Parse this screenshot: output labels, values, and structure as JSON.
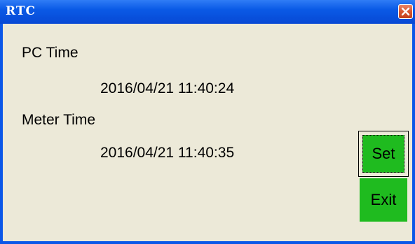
{
  "window": {
    "title": "RTC",
    "close_icon": "close-x-icon"
  },
  "pc": {
    "label": "PC Time",
    "value": "2016/04/21 11:40:24"
  },
  "meter": {
    "label": "Meter Time",
    "value": "2016/04/21 11:40:35"
  },
  "buttons": {
    "set_label": "Set",
    "exit_label": "Exit"
  },
  "colors": {
    "title_bar": "#0a5ae6",
    "client_bg": "#ece9d8",
    "button_green": "#1fbb1f",
    "close_red": "#d9552f"
  }
}
